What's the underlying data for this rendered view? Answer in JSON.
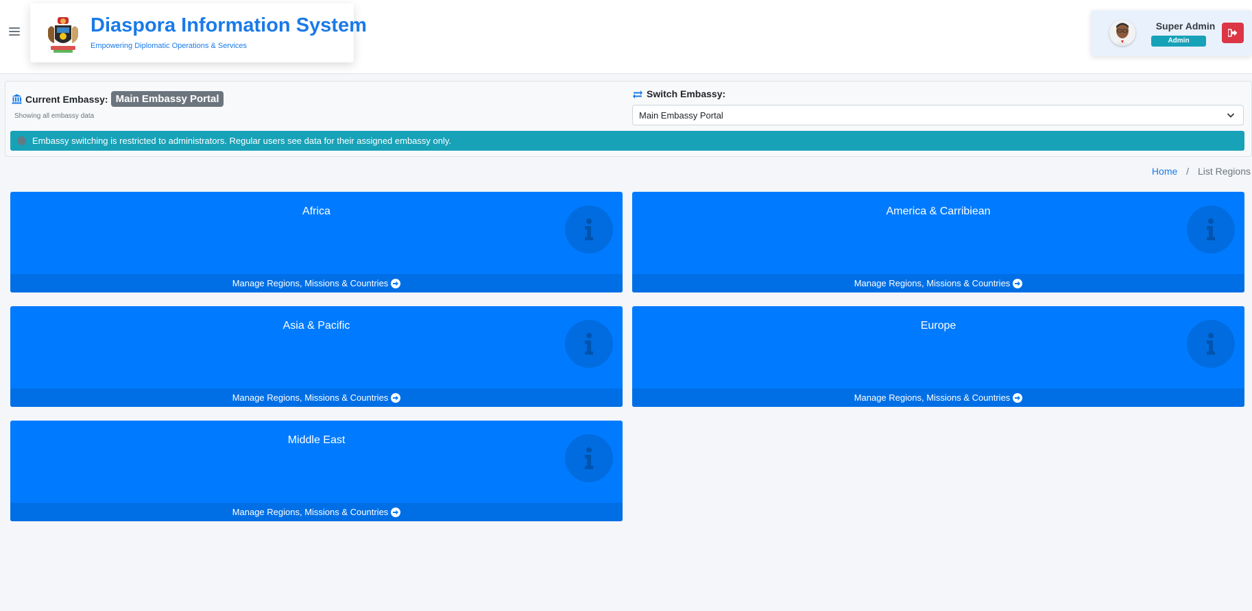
{
  "header": {
    "title": "Diaspora Information System",
    "subtitle": "Empowering Diplomatic Operations & Services"
  },
  "user": {
    "name": "Super Admin",
    "role": "Admin"
  },
  "embassy": {
    "current_label": "Current Embassy:",
    "current_value": "Main Embassy Portal",
    "current_sub": "Showing all embassy data",
    "switch_label": "Switch Embassy:",
    "selected": "Main Embassy Portal",
    "notice": "Embassy switching is restricted to administrators. Regular users see data for their assigned embassy only."
  },
  "breadcrumb": {
    "home": "Home",
    "current": "List Regions"
  },
  "regions": [
    {
      "name": "Africa",
      "link": "Manage Regions, Missions & Countries"
    },
    {
      "name": "America & Carribiean",
      "link": "Manage Regions, Missions & Countries"
    },
    {
      "name": "Asia & Pacific",
      "link": "Manage Regions, Missions & Countries"
    },
    {
      "name": "Europe",
      "link": "Manage Regions, Missions & Countries"
    },
    {
      "name": "Middle East",
      "link": "Manage Regions, Missions & Countries"
    }
  ],
  "colors": {
    "card": "#007bff",
    "brand": "#1a7ae8",
    "alert": "#17a2b8",
    "logout": "#dc3545"
  },
  "icons": {
    "card": "info-icon",
    "footer": "arrow-circle-right-icon",
    "logout": "sign-out-icon",
    "embassy": "bank-icon",
    "switch": "exchange-icon"
  }
}
